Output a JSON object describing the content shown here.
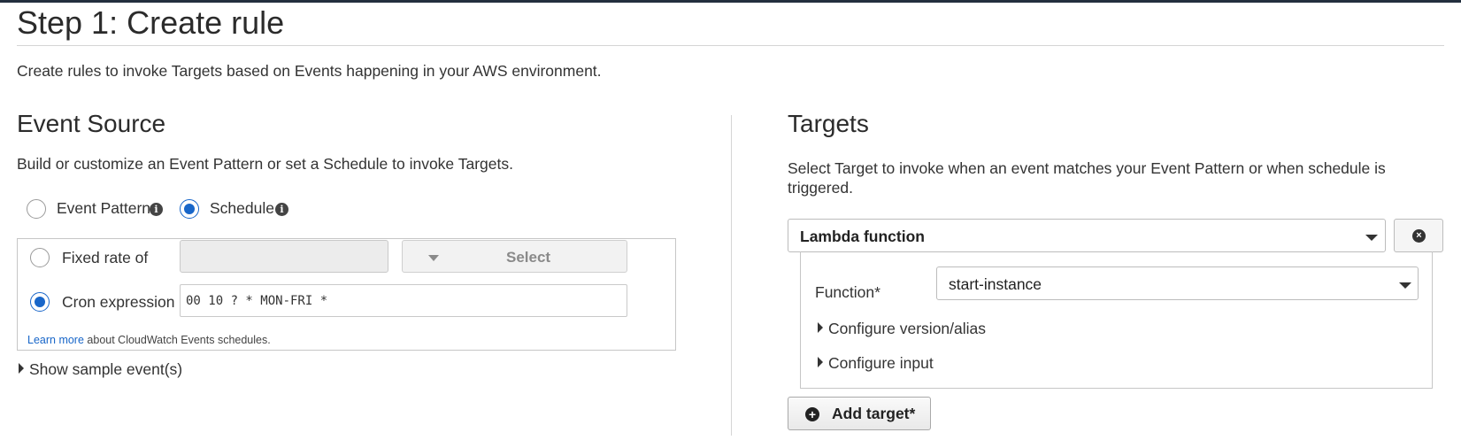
{
  "page": {
    "title": "Step 1: Create rule",
    "intro": "Create rules to invoke Targets based on Events happening in your AWS environment."
  },
  "event_source": {
    "title": "Event Source",
    "description": "Build or customize an Event Pattern or set a Schedule to invoke Targets.",
    "options": [
      {
        "label": "Event Pattern",
        "selected": false,
        "icon": "info-icon"
      },
      {
        "label": "Schedule",
        "selected": true,
        "icon": "info-icon"
      }
    ],
    "schedule": {
      "fixed_rate_label": "Fixed rate of",
      "fixed_rate_selected": false,
      "fixed_rate_value": "",
      "unit_select_label": "Select",
      "cron_label": "Cron expression",
      "cron_selected": true,
      "cron_value": "00 10 ? * MON-FRI *",
      "learn_more_link": "Learn more",
      "learn_more_text": "about CloudWatch Events schedules."
    },
    "show_sample": "Show sample event(s)"
  },
  "targets": {
    "title": "Targets",
    "description_line1": "Select Target to invoke when an event matches your Event Pattern or when schedule is",
    "description_line2": "triggered.",
    "target_type": "Lambda function",
    "function_label": "Function*",
    "function_value": "start-instance",
    "configure_version": "Configure version/alias",
    "configure_input": "Configure input",
    "add_target": "Add target*"
  },
  "colors": {
    "accent": "#1866c9",
    "link": "#1866c9",
    "divider": "#d5d5d5",
    "top_bar": "#232f3e"
  }
}
